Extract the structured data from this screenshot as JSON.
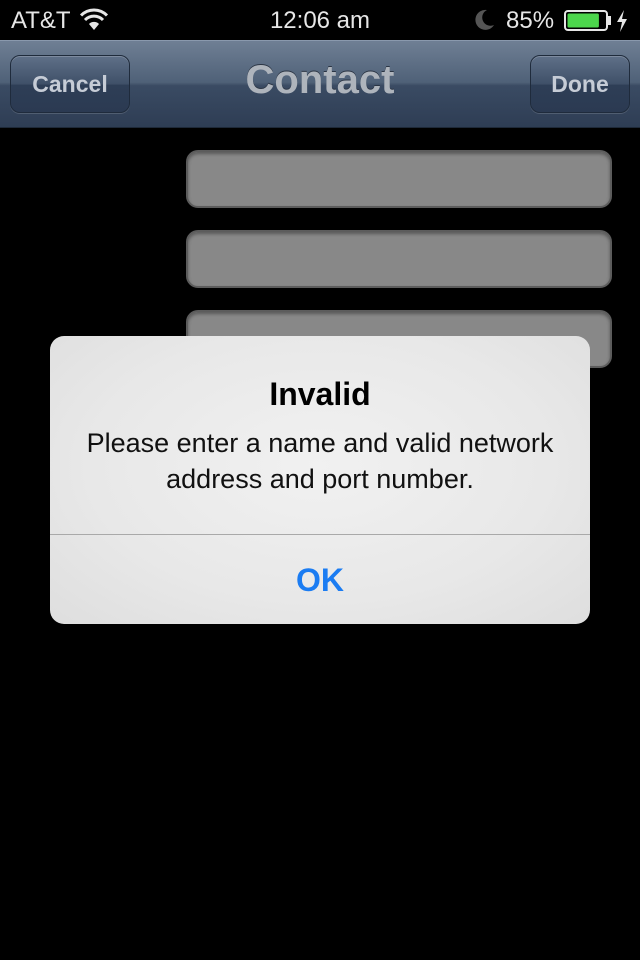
{
  "status_bar": {
    "carrier": "AT&T",
    "time": "12:06 am",
    "battery_percent": "85%",
    "battery_level": 0.85,
    "icons": [
      "wifi-icon",
      "moon-icon",
      "battery-icon",
      "charging-bolt-icon"
    ]
  },
  "nav": {
    "title": "Contact",
    "cancel_label": "Cancel",
    "done_label": "Done"
  },
  "form": {
    "fields": [
      {
        "value": ""
      },
      {
        "value": ""
      },
      {
        "value": ""
      }
    ]
  },
  "alert": {
    "title": "Invalid",
    "message": "Please enter a name and valid network address and port number.",
    "ok_label": "OK"
  },
  "colors": {
    "accent": "#1b7cf2",
    "battery_fill": "#4cd64c"
  }
}
